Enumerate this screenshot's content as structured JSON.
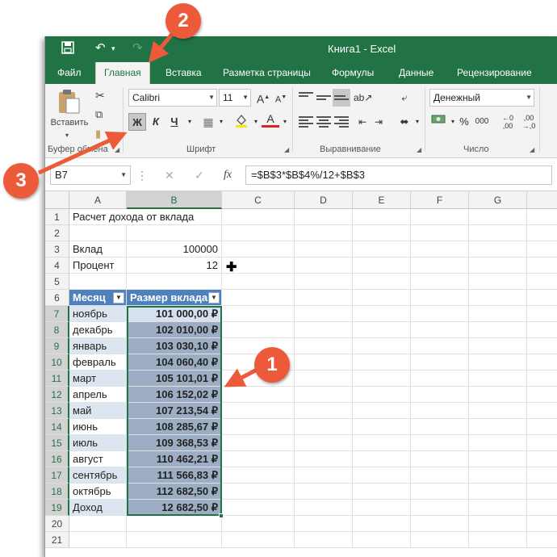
{
  "window": {
    "title": "Книга1 - Excel"
  },
  "tabs": [
    "Файл",
    "Главная",
    "Вставка",
    "Разметка страницы",
    "Формулы",
    "Данные",
    "Рецензирование"
  ],
  "ribbon": {
    "paste_label": "Вставить",
    "clipboard_label": "Буфер обмена",
    "font_name": "Calibri",
    "font_size": "11",
    "font_label": "Шрифт",
    "bold": "Ж",
    "italic": "К",
    "underline": "Ч",
    "alignment_label": "Выравнивание",
    "number_format": "Денежный",
    "number_label": "Число",
    "pct": "%",
    "thousands": "000",
    "grow": "A",
    "shrink": "A",
    "font_color": "A"
  },
  "formula_bar": {
    "name_box": "B7",
    "fx": "fx",
    "formula": "=$B$3*$B$4%/12+$B$3"
  },
  "columns": [
    "A",
    "B",
    "C",
    "D",
    "E",
    "F",
    "G"
  ],
  "rows": [
    "1",
    "2",
    "3",
    "4",
    "5",
    "6",
    "7",
    "8",
    "9",
    "10",
    "11",
    "12",
    "13",
    "14",
    "15",
    "16",
    "17",
    "18",
    "19",
    "20",
    "21"
  ],
  "sheet": {
    "a1": "Расчет дохода от вклада",
    "a3": "Вклад",
    "b3": "100000",
    "a4": "Процент",
    "b4": "12",
    "table_headers": [
      "Месяц",
      "Размер вклада"
    ],
    "table_rows": [
      [
        "ноябрь",
        "101 000,00 ₽"
      ],
      [
        "декабрь",
        "102 010,00 ₽"
      ],
      [
        "январь",
        "103 030,10 ₽"
      ],
      [
        "февраль",
        "104 060,40 ₽"
      ],
      [
        "март",
        "105 101,01 ₽"
      ],
      [
        "апрель",
        "106 152,02 ₽"
      ],
      [
        "май",
        "107 213,54 ₽"
      ],
      [
        "июнь",
        "108 285,67 ₽"
      ],
      [
        "июль",
        "109 368,53 ₽"
      ],
      [
        "август",
        "110 462,21 ₽"
      ],
      [
        "сентябрь",
        "111 566,83 ₽"
      ],
      [
        "октябрь",
        "112 682,50 ₽"
      ],
      [
        "Доход",
        "12 682,50 ₽"
      ]
    ]
  },
  "annotations": [
    "1",
    "2",
    "3"
  ],
  "colors": {
    "excel_green": "#217346",
    "table_header": "#4f81bd",
    "band": "#dce6f1",
    "badge": "#ec5a3a"
  }
}
